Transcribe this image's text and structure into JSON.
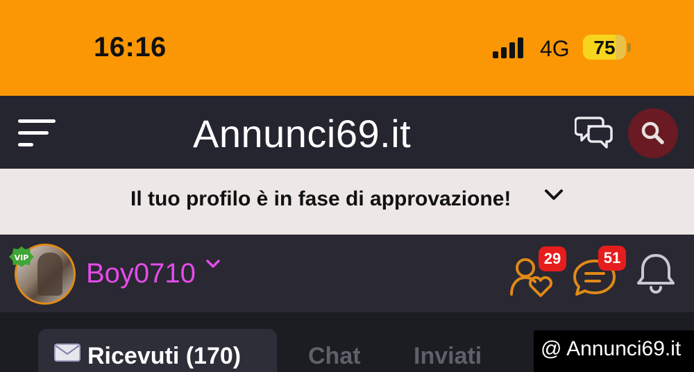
{
  "status_bar": {
    "time": "16:16",
    "network": "4G",
    "battery_level": "75",
    "battery_fraction": 0.75,
    "background_color": "#fb9705"
  },
  "header": {
    "logo": "Annunci69.it",
    "menu_icon": "hamburger-menu-icon",
    "chat_icon": "chat-bubbles-icon",
    "search_icon": "search-icon",
    "search_button_color": "#6a1a22"
  },
  "notice": {
    "text": "Il tuo profilo è in fase di approvazione!",
    "chevron_icon": "chevron-down-icon"
  },
  "user": {
    "username": "Boy0710",
    "vip_label": "VIP",
    "username_color": "#e54be8",
    "friends_count": "29",
    "messages_count": "51",
    "notifications_icon": "bell-icon",
    "accent_color": "#e08a18"
  },
  "tabs": [
    {
      "label": "Ricevuti (170)",
      "icon": "envelope-icon",
      "active": true
    },
    {
      "label": "Chat",
      "active": false
    },
    {
      "label": "Inviati",
      "active": false
    }
  ],
  "watermark": {
    "text": "@ Annunci69.it"
  }
}
